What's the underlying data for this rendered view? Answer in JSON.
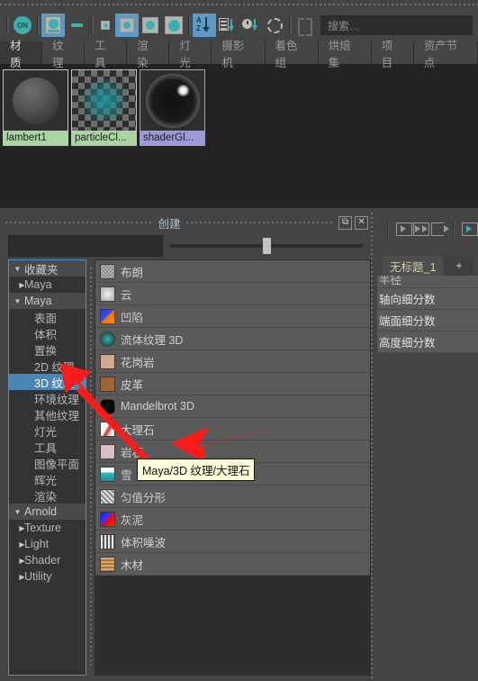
{
  "toolbar": {
    "on_label": "ON",
    "search_placeholder": "搜索...",
    "icons": [
      "on-toggle-icon",
      "swatch-with-label-icon",
      "dash-icon",
      "tiny-swatch-icon",
      "small-swatch-icon",
      "medium-swatch-icon",
      "large-swatch-icon",
      "sort-alpha-icon",
      "sort-generate-icon",
      "sort-time-icon",
      "refresh-icon",
      "fit-brackets-icon"
    ]
  },
  "tabs": [
    {
      "label": "材质",
      "active": true
    },
    {
      "label": "纹理",
      "active": false
    },
    {
      "label": "工具",
      "active": false
    },
    {
      "label": "渲染",
      "active": false
    },
    {
      "label": "灯光",
      "active": false
    },
    {
      "label": "摄影机",
      "active": false
    },
    {
      "label": "着色组",
      "active": false
    },
    {
      "label": "烘焙集",
      "active": false
    },
    {
      "label": "项目",
      "active": false
    },
    {
      "label": "资产节点",
      "active": false
    }
  ],
  "swatches": [
    {
      "name": "lambert1",
      "type": "matte",
      "color": "#a8d5a2"
    },
    {
      "name": "particleCl...",
      "type": "checker",
      "color": "#a8d5a2"
    },
    {
      "name": "shaderGl...",
      "type": "glossy",
      "color": "#9a9ad8"
    }
  ],
  "create_panel": {
    "title": "创建",
    "filter_value": "",
    "slider_value": 48,
    "restore_icon": "restore-window-icon",
    "close_icon": "close-icon",
    "tree": [
      {
        "label": "收藏夹",
        "twisty": "down",
        "group": true,
        "indent": 0,
        "selected": false
      },
      {
        "label": "Maya",
        "twisty": "right",
        "group": false,
        "indent": 0,
        "selected": false
      },
      {
        "label": "Maya",
        "twisty": "down",
        "group": true,
        "indent": 0,
        "selected": false
      },
      {
        "label": "表面",
        "twisty": "none",
        "group": false,
        "indent": 1,
        "selected": false
      },
      {
        "label": "体积",
        "twisty": "none",
        "group": false,
        "indent": 1,
        "selected": false
      },
      {
        "label": "置换",
        "twisty": "none",
        "group": false,
        "indent": 1,
        "selected": false
      },
      {
        "label": "2D 纹理",
        "twisty": "none",
        "group": false,
        "indent": 1,
        "selected": false
      },
      {
        "label": "3D 纹理",
        "twisty": "none",
        "group": false,
        "indent": 1,
        "selected": true
      },
      {
        "label": "环境纹理",
        "twisty": "none",
        "group": false,
        "indent": 1,
        "selected": false
      },
      {
        "label": "其他纹理",
        "twisty": "none",
        "group": false,
        "indent": 1,
        "selected": false
      },
      {
        "label": "灯光",
        "twisty": "none",
        "group": false,
        "indent": 1,
        "selected": false
      },
      {
        "label": "工具",
        "twisty": "none",
        "group": false,
        "indent": 1,
        "selected": false
      },
      {
        "label": "图像平面",
        "twisty": "none",
        "group": false,
        "indent": 1,
        "selected": false
      },
      {
        "label": "辉光",
        "twisty": "none",
        "group": false,
        "indent": 1,
        "selected": false
      },
      {
        "label": "渲染",
        "twisty": "none",
        "group": false,
        "indent": 1,
        "selected": false
      },
      {
        "label": "Arnold",
        "twisty": "down",
        "group": true,
        "indent": 0,
        "selected": false
      },
      {
        "label": "Texture",
        "twisty": "right",
        "group": false,
        "indent": 0,
        "selected": false
      },
      {
        "label": "Light",
        "twisty": "right",
        "group": false,
        "indent": 0,
        "selected": false
      },
      {
        "label": "Shader",
        "twisty": "right",
        "group": false,
        "indent": 0,
        "selected": false
      },
      {
        "label": "Utility",
        "twisty": "right",
        "group": false,
        "indent": 0,
        "selected": false
      }
    ],
    "node_list": [
      {
        "label": "布朗",
        "icon": "brownian-texture-icon",
        "swatch": "ti-brown"
      },
      {
        "label": "云",
        "icon": "cloud-texture-icon",
        "swatch": "ti-cloud"
      },
      {
        "label": "凹陷",
        "icon": "dent-texture-icon",
        "swatch": "ti-dent"
      },
      {
        "label": "流体纹理 3D",
        "icon": "fluid-texture-3d-icon",
        "swatch": "ti-fluid"
      },
      {
        "label": "花岗岩",
        "icon": "granite-texture-icon",
        "swatch": "ti-granite"
      },
      {
        "label": "皮革",
        "icon": "leather-texture-icon",
        "swatch": "ti-leather"
      },
      {
        "label": "Mandelbrot 3D",
        "icon": "mandelbrot-3d-icon",
        "swatch": "ti-mandel"
      },
      {
        "label": "大理石",
        "icon": "marble-texture-icon",
        "swatch": "ti-marble"
      },
      {
        "label": "岩石",
        "icon": "rock-texture-icon",
        "swatch": "ti-rock"
      },
      {
        "label": "雪",
        "icon": "snow-texture-icon",
        "swatch": "ti-snow"
      },
      {
        "label": "匀值分形",
        "icon": "solid-fractal-icon",
        "swatch": "ti-fractal"
      },
      {
        "label": "灰泥",
        "icon": "stucco-texture-icon",
        "swatch": "ti-mud"
      },
      {
        "label": "体积噪波",
        "icon": "volume-noise-icon",
        "swatch": "ti-volume"
      },
      {
        "label": "木材",
        "icon": "wood-texture-icon",
        "swatch": "ti-wood"
      }
    ],
    "tooltip": "Maya/3D 纹理/大理石"
  },
  "right_panel": {
    "tabs": [
      {
        "label": "无标题_1",
        "active": true
      },
      {
        "label": "+",
        "active": false
      }
    ],
    "attr_rows": [
      "半径",
      "轴向细分数",
      "端面细分数",
      "高度细分数"
    ],
    "tool_icons": [
      "input-connection-icon",
      "both-connections-icon",
      "output-connection-icon",
      "graph-icon"
    ]
  }
}
